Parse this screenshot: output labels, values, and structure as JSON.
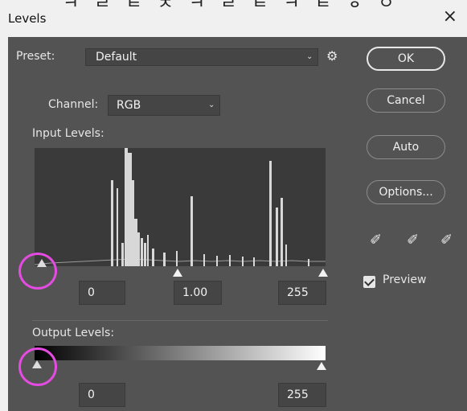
{
  "window": {
    "title": "Levels",
    "close_symbol": "×",
    "partial_header_text": "ㅋ ㄹ   ㅌ ㅊ ㅋ ㄹ ㅌ   ㅋ ㅌ ㅎ ㅇ"
  },
  "preset": {
    "label": "Preset:",
    "value": "Default"
  },
  "channel": {
    "label": "Channel:",
    "value": "RGB"
  },
  "input_levels": {
    "label": "Input Levels:",
    "black": "0",
    "gamma": "1.00",
    "white": "255"
  },
  "output_levels": {
    "label": "Output Levels:",
    "black": "0",
    "white": "255"
  },
  "buttons": {
    "ok": "OK",
    "cancel": "Cancel",
    "auto": "Auto",
    "options": "Options..."
  },
  "preview": {
    "label": "Preview",
    "checked": true
  },
  "icons": [
    "gear-icon",
    "chevron-down-icon",
    "eyedropper-black-icon",
    "eyedropper-gray-icon",
    "eyedropper-white-icon",
    "checkbox-icon"
  ],
  "colors": {
    "dialog_bg": "#535353",
    "field_bg": "#454545",
    "highlight_circle": "#e44be0"
  }
}
